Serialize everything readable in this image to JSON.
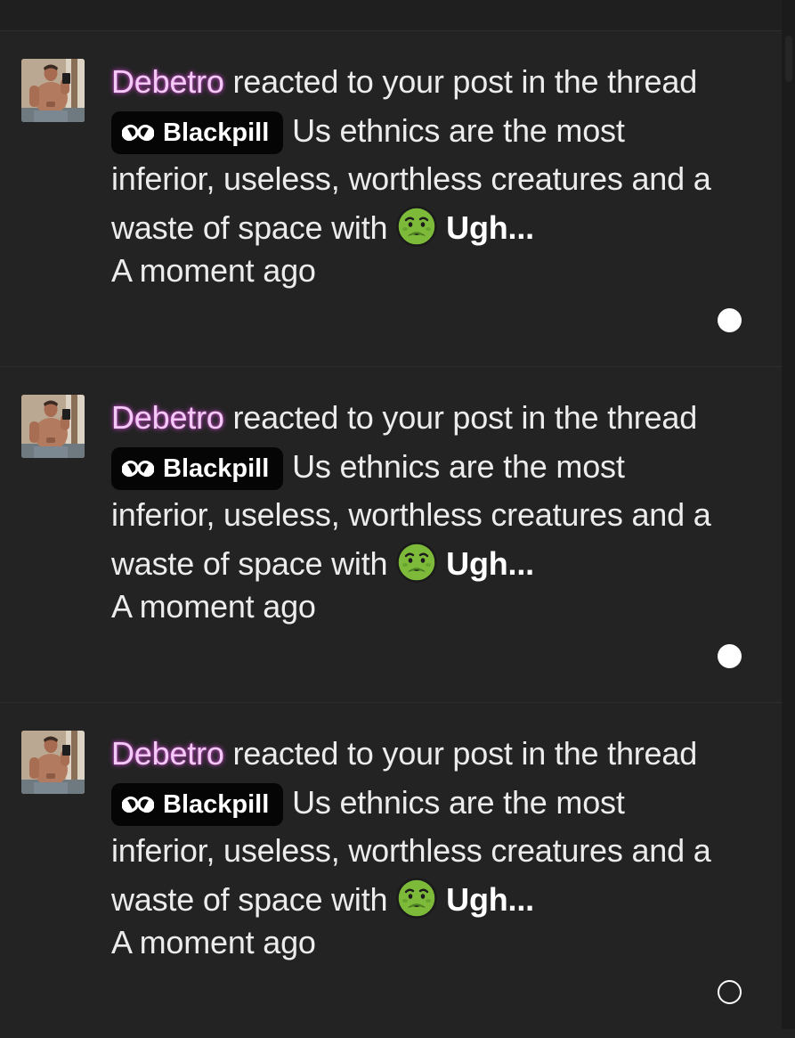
{
  "colors": {
    "background": "#232323",
    "username_glow": "#e250e6",
    "badge_bg": "#050505",
    "emoji_green": "#7dba3a"
  },
  "notifications": [
    {
      "username": "Debetro",
      "text_before": " reacted to your post in the thread ",
      "prefix_icon": "pill-icon",
      "prefix_label": "Blackpill",
      "thread_title": " Us ethnics are the most inferior, useless, worthless creatures and a waste of space with ",
      "reaction_icon": "nauseated-face-icon",
      "reaction_label": "Ugh...",
      "time": "A moment ago",
      "unread": true
    },
    {
      "username": "Debetro",
      "text_before": " reacted to your post in the thread ",
      "prefix_icon": "pill-icon",
      "prefix_label": "Blackpill",
      "thread_title": " Us ethnics are the most inferior, useless, worthless creatures and a waste of space with ",
      "reaction_icon": "nauseated-face-icon",
      "reaction_label": "Ugh...",
      "time": "A moment ago",
      "unread": true
    },
    {
      "username": "Debetro",
      "text_before": " reacted to your post in the thread ",
      "prefix_icon": "pill-icon",
      "prefix_label": "Blackpill",
      "thread_title": " Us ethnics are the most inferior, useless, worthless creatures and a waste of space with ",
      "reaction_icon": "nauseated-face-icon",
      "reaction_label": "Ugh...",
      "time": "A moment ago",
      "unread": false
    }
  ]
}
